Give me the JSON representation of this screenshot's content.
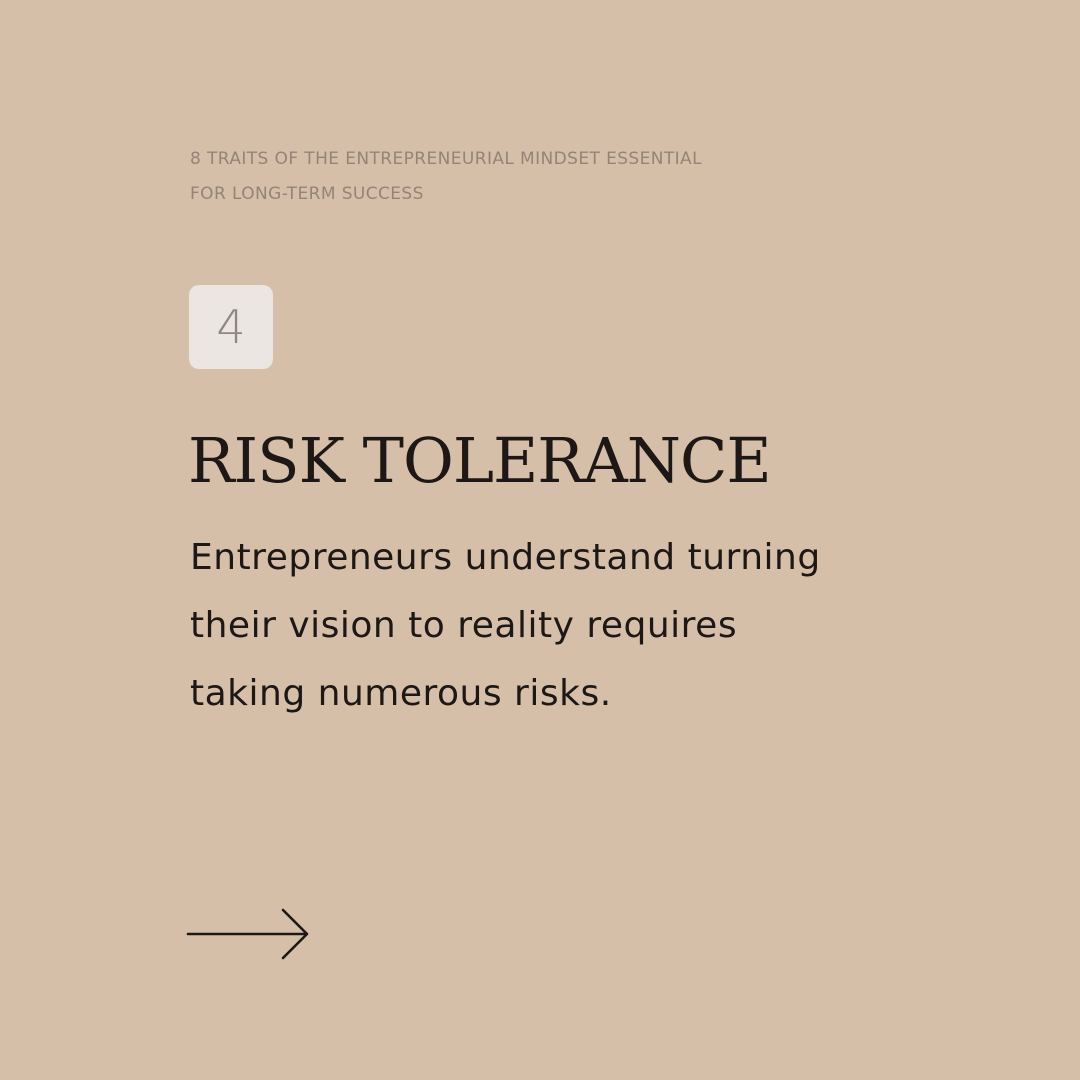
{
  "series_title": {
    "line1": "8 TRAITS OF THE ENTREPRENEURIAL MINDSET ESSENTIAL",
    "line2": "FOR LONG-TERM SUCCESS"
  },
  "trait": {
    "number": "4",
    "heading": "RISK TOLERANCE",
    "body_lines": [
      "Entrepreneurs understand turning",
      "their vision to reality requires",
      "taking numerous risks."
    ]
  },
  "icons": {
    "next": "arrow-right-icon"
  },
  "colors": {
    "background": "#d6bfa8",
    "badge": "#ece6e2",
    "text_dark": "#1d1815",
    "text_muted": "#948477"
  }
}
